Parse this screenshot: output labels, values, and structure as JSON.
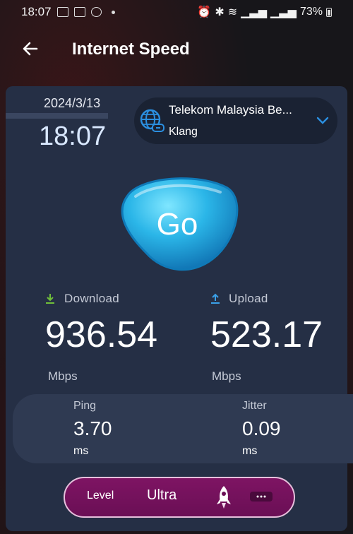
{
  "status_bar": {
    "time": "18:07",
    "battery": "73%"
  },
  "app_bar": {
    "title": "Internet Speed"
  },
  "datetime": {
    "date": "2024/3/13",
    "time": "18:07"
  },
  "server": {
    "name": "Telekom Malaysia Be...",
    "city": "Klang"
  },
  "go_button": {
    "label": "Go"
  },
  "download": {
    "label": "Download",
    "value": "936.54",
    "unit": "Mbps"
  },
  "upload": {
    "label": "Upload",
    "value": "523.17",
    "unit": "Mbps"
  },
  "ping": {
    "label": "Ping",
    "value": "3.70",
    "unit": "ms"
  },
  "jitter": {
    "label": "Jitter",
    "value": "0.09",
    "unit": "ms"
  },
  "level": {
    "label": "Level",
    "value": "Ultra"
  },
  "colors": {
    "download_arrow": "#6fbf3a",
    "upload_arrow": "#3aa0e8",
    "go_button": "#2ab4e6",
    "level_pill": "#7e1463"
  },
  "icons": {
    "back": "back-arrow-icon",
    "globe": "globe-link-icon",
    "chevron": "chevron-down-icon",
    "rocket": "rocket-icon"
  }
}
